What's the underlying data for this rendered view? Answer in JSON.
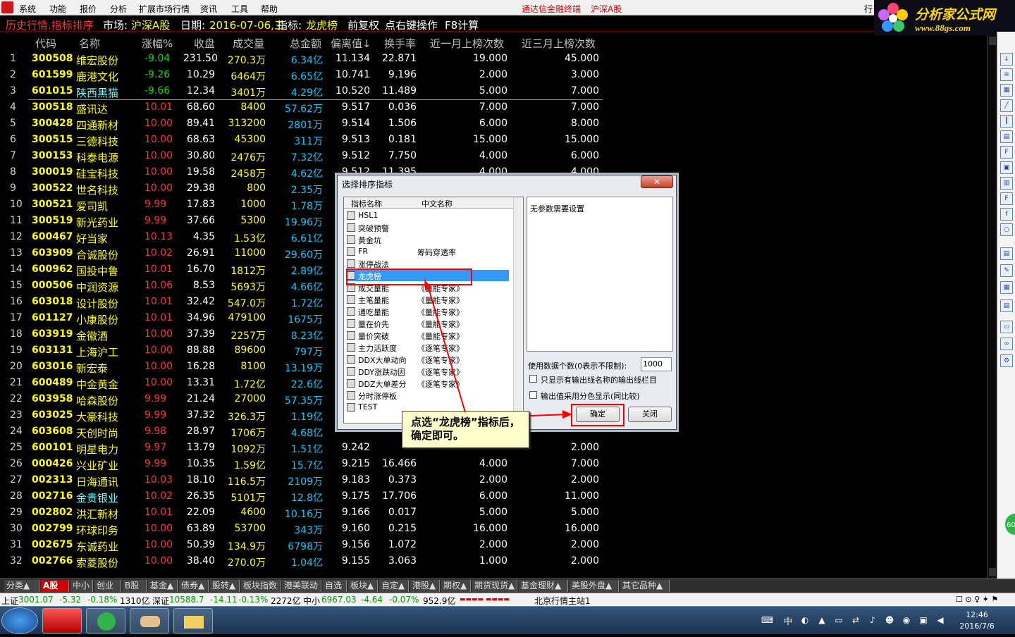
{
  "menubar": {
    "items": [
      "系统",
      "功能",
      "报价",
      "分析",
      "扩展市场行情",
      "资讯",
      "工具",
      "帮助"
    ],
    "right_text": "通达信金融终端",
    "market_text": "沪深A股",
    "right_cut": "行"
  },
  "brand": {
    "title": "分析家公式网",
    "url": "www.88gs.com"
  },
  "header": {
    "title": "历史行情.指标排序",
    "market_label": "市场:",
    "market": "沪深A股",
    "date_label": "日期:",
    "date": "2016-07-06,三",
    "indicator_label": "指标:",
    "indicator": "龙虎榜",
    "adjust": "前复权",
    "hint": "点右键操作",
    "calc": "F8计算"
  },
  "columns": [
    "代码",
    "名称",
    "涨幅%",
    "收盘",
    "成交量",
    "总金额",
    "偏离值↓",
    "换手率",
    "近一月上榜次数",
    "近三月上榜次数"
  ],
  "rows": [
    {
      "n": "1",
      "code": "300508",
      "name": "维宏股份",
      "pct": "-9.04",
      "close": "231.50",
      "vol": "270.3万",
      "amt": "6.34亿",
      "dev": "11.134",
      "turn": "22.871",
      "m1": "19.000",
      "m3": "45.000"
    },
    {
      "n": "2",
      "code": "601599",
      "name": "鹿港文化",
      "pct": "-9.26",
      "close": "10.29",
      "vol": "6464万",
      "amt": "6.65亿",
      "dev": "10.741",
      "turn": "9.196",
      "m1": "2.000",
      "m3": "3.000"
    },
    {
      "n": "3",
      "code": "601015",
      "name": "陕西黑猫",
      "pct": "-9.66",
      "close": "12.34",
      "vol": "3401万",
      "amt": "4.29亿",
      "dev": "10.520",
      "turn": "11.489",
      "m1": "5.000",
      "m3": "7.000"
    },
    {
      "n": "4",
      "code": "300518",
      "name": "盛讯达",
      "pct": "10.01",
      "close": "68.60",
      "vol": "8400",
      "amt": "57.62万",
      "dev": "9.517",
      "turn": "0.036",
      "m1": "7.000",
      "m3": "7.000"
    },
    {
      "n": "5",
      "code": "300428",
      "name": "四通新材",
      "pct": "10.00",
      "close": "89.41",
      "vol": "313200",
      "amt": "2801万",
      "dev": "9.514",
      "turn": "1.506",
      "m1": "6.000",
      "m3": "8.000"
    },
    {
      "n": "6",
      "code": "300515",
      "name": "三德科技",
      "pct": "10.00",
      "close": "68.63",
      "vol": "45300",
      "amt": "311万",
      "dev": "9.513",
      "turn": "0.181",
      "m1": "15.000",
      "m3": "15.000"
    },
    {
      "n": "7",
      "code": "300153",
      "name": "科泰电源",
      "pct": "10.00",
      "close": "30.80",
      "vol": "2476万",
      "amt": "7.32亿",
      "dev": "9.512",
      "turn": "7.750",
      "m1": "4.000",
      "m3": "6.000"
    },
    {
      "n": "8",
      "code": "300019",
      "name": "硅宝科技",
      "pct": "10.00",
      "close": "19.58",
      "vol": "2458万",
      "amt": "4.62亿",
      "dev": "9.512",
      "turn": "11.395",
      "m1": "4.000",
      "m3": "4.000"
    },
    {
      "n": "9",
      "code": "300522",
      "name": "世名科技",
      "pct": "10.00",
      "close": "29.38",
      "vol": "800",
      "amt": "2.35万",
      "dev": "",
      "turn": "",
      "m1": "",
      "m3": ""
    },
    {
      "n": "10",
      "code": "300521",
      "name": "爱司凯",
      "pct": "9.99",
      "close": "17.83",
      "vol": "1000",
      "amt": "1.78万",
      "dev": "",
      "turn": "",
      "m1": "",
      "m3": ""
    },
    {
      "n": "11",
      "code": "300519",
      "name": "新光药业",
      "pct": "9.99",
      "close": "37.66",
      "vol": "5300",
      "amt": "19.96万",
      "dev": "",
      "turn": "",
      "m1": "",
      "m3": ""
    },
    {
      "n": "12",
      "code": "600467",
      "name": "好当家",
      "pct": "10.13",
      "close": "4.35",
      "vol": "1.53亿",
      "amt": "6.61亿",
      "dev": "",
      "turn": "",
      "m1": "",
      "m3": ""
    },
    {
      "n": "13",
      "code": "603909",
      "name": "合诚股份",
      "pct": "10.02",
      "close": "26.91",
      "vol": "11000",
      "amt": "29.60万",
      "dev": "",
      "turn": "",
      "m1": "",
      "m3": ""
    },
    {
      "n": "14",
      "code": "600962",
      "name": "国投中鲁",
      "pct": "10.01",
      "close": "16.70",
      "vol": "1812万",
      "amt": "2.89亿",
      "dev": "",
      "turn": "",
      "m1": "",
      "m3": ""
    },
    {
      "n": "15",
      "code": "000506",
      "name": "中润资源",
      "pct": "10.06",
      "close": "8.53",
      "vol": "5693万",
      "amt": "4.66亿",
      "dev": "",
      "turn": "",
      "m1": "",
      "m3": ""
    },
    {
      "n": "16",
      "code": "603018",
      "name": "设计股份",
      "pct": "10.01",
      "close": "32.42",
      "vol": "547.0万",
      "amt": "1.72亿",
      "dev": "",
      "turn": "",
      "m1": "",
      "m3": ""
    },
    {
      "n": "17",
      "code": "601127",
      "name": "小康股份",
      "pct": "10.01",
      "close": "34.96",
      "vol": "479100",
      "amt": "1675万",
      "dev": "",
      "turn": "",
      "m1": "",
      "m3": ""
    },
    {
      "n": "18",
      "code": "603919",
      "name": "金徽酒",
      "pct": "10.00",
      "close": "37.39",
      "vol": "2257万",
      "amt": "8.23亿",
      "dev": "",
      "turn": "",
      "m1": "",
      "m3": ""
    },
    {
      "n": "19",
      "code": "603131",
      "name": "上海沪工",
      "pct": "10.00",
      "close": "88.88",
      "vol": "89600",
      "amt": "797万",
      "dev": "",
      "turn": "",
      "m1": "",
      "m3": ""
    },
    {
      "n": "20",
      "code": "603016",
      "name": "新宏泰",
      "pct": "10.00",
      "close": "16.28",
      "vol": "8100",
      "amt": "13.19万",
      "dev": "",
      "turn": "",
      "m1": "",
      "m3": ""
    },
    {
      "n": "21",
      "code": "600489",
      "name": "中金黄金",
      "pct": "10.00",
      "close": "13.31",
      "vol": "1.72亿",
      "amt": "22.6亿",
      "dev": "",
      "turn": "",
      "m1": "",
      "m3": ""
    },
    {
      "n": "22",
      "code": "603958",
      "name": "哈森股份",
      "pct": "9.99",
      "close": "21.24",
      "vol": "27000",
      "amt": "57.35万",
      "dev": "",
      "turn": "",
      "m1": "",
      "m3": ""
    },
    {
      "n": "23",
      "code": "603025",
      "name": "大豪科技",
      "pct": "9.99",
      "close": "37.32",
      "vol": "326.3万",
      "amt": "1.19亿",
      "dev": "",
      "turn": "",
      "m1": "",
      "m3": ""
    },
    {
      "n": "24",
      "code": "603608",
      "name": "天创时尚",
      "pct": "9.98",
      "close": "28.97",
      "vol": "1706万",
      "amt": "4.68亿",
      "dev": "",
      "turn": "",
      "m1": "",
      "m3": ""
    },
    {
      "n": "25",
      "code": "600101",
      "name": "明星电力",
      "pct": "9.97",
      "close": "13.79",
      "vol": "1092万",
      "amt": "1.51亿",
      "dev": "9.242",
      "turn": "",
      "m1": "",
      "m3": "2.000"
    },
    {
      "n": "26",
      "code": "000426",
      "name": "兴业矿业",
      "pct": "9.99",
      "close": "10.35",
      "vol": "1.59亿",
      "amt": "15.7亿",
      "dev": "9.215",
      "turn": "16.466",
      "m1": "4.000",
      "m3": "7.000"
    },
    {
      "n": "27",
      "code": "002313",
      "name": "日海通讯",
      "pct": "10.03",
      "close": "18.10",
      "vol": "116.5万",
      "amt": "2109万",
      "dev": "9.183",
      "turn": "0.373",
      "m1": "2.000",
      "m3": "2.000"
    },
    {
      "n": "28",
      "code": "002716",
      "name": "金贵银业",
      "pct": "10.02",
      "close": "26.35",
      "vol": "5101万",
      "amt": "12.8亿",
      "dev": "9.175",
      "turn": "17.706",
      "m1": "6.000",
      "m3": "11.000"
    },
    {
      "n": "29",
      "code": "002802",
      "name": "洪汇新材",
      "pct": "10.01",
      "close": "22.09",
      "vol": "4600",
      "amt": "10.16万",
      "dev": "9.166",
      "turn": "0.017",
      "m1": "5.000",
      "m3": "5.000"
    },
    {
      "n": "30",
      "code": "002799",
      "name": "环球印务",
      "pct": "10.00",
      "close": "63.89",
      "vol": "53700",
      "amt": "343万",
      "dev": "9.160",
      "turn": "0.215",
      "m1": "16.000",
      "m3": "16.000"
    },
    {
      "n": "31",
      "code": "002675",
      "name": "东诚药业",
      "pct": "10.00",
      "close": "50.39",
      "vol": "134.9万",
      "amt": "6798万",
      "dev": "9.156",
      "turn": "1.072",
      "m1": "2.000",
      "m3": "2.000"
    },
    {
      "n": "32",
      "code": "002766",
      "name": "索菱股份",
      "pct": "10.00",
      "close": "38.40",
      "vol": "270.0万",
      "amt": "1.04亿",
      "dev": "9.155",
      "turn": "3.063",
      "m1": "1.000",
      "m3": "2.000"
    }
  ],
  "dialog": {
    "title": "选择排序指标",
    "col_name": "指标名称",
    "col_cn": "中文名称",
    "items": [
      {
        "name": "HSL1",
        "cn": ""
      },
      {
        "name": "突破预警",
        "cn": ""
      },
      {
        "name": "黄金坑",
        "cn": ""
      },
      {
        "name": "FR",
        "cn": "筹码穿透率"
      },
      {
        "name": "涨停战法",
        "cn": ""
      },
      {
        "name": "龙虎榜",
        "cn": ""
      },
      {
        "name": "成交量能",
        "cn": "《量能专家》"
      },
      {
        "name": "主笔量能",
        "cn": "《量能专家》"
      },
      {
        "name": "通吃量能",
        "cn": "《量能专家》"
      },
      {
        "name": "量在价先",
        "cn": "《量能专家》"
      },
      {
        "name": "量价突破",
        "cn": "《量能专家》"
      },
      {
        "name": "主力活跃度",
        "cn": "《逐笔专家》"
      },
      {
        "name": "DDX大单动向",
        "cn": "《逐笔专家》"
      },
      {
        "name": "DDY涨跌动因",
        "cn": "《逐笔专家》"
      },
      {
        "name": "DDZ大单差分",
        "cn": "《逐笔专家》"
      },
      {
        "name": "分时涨停板",
        "cn": ""
      },
      {
        "name": "TEST",
        "cn": ""
      }
    ],
    "info": "无参数需要设置",
    "count_label": "使用数据个数(0表示不限制):",
    "count_value": "1000",
    "opt1": "只显示有输出线名称的输出线栏目",
    "opt2": "输出值采用分色显示(同比较)",
    "ok": "确定",
    "close": "关闭"
  },
  "callout": "点选“龙虎榜”指标后，确定即可。",
  "tabs": [
    "分类▲",
    "A股",
    "中小",
    "创业",
    "B股",
    "基金▲",
    "债券▲",
    "股转▲",
    "板块指数",
    "港美联动",
    "自选",
    "板块▲",
    "自定▲",
    "港股▲",
    "期权▲",
    "期货现货▲",
    "基金理财▲",
    "美股外盘▲",
    "其它品种▲"
  ],
  "status": {
    "sh_label": "上证",
    "sh": "3001.07",
    "sh_chg": "-5.32",
    "sh_pct": "-0.18%",
    "sh_amt": "1310亿",
    "sz_label": "深证",
    "sz": "10588.7",
    "sz_chg": "-14.11",
    "sz_pct": "-0.13%",
    "sz_amt": "2272亿",
    "zx_label": "中小",
    "zx": "6967.03",
    "zx_chg": "-4.64",
    "zx_pct": "-0.07%",
    "zx_amt": "952.9亿",
    "server": "北京行情主站1"
  },
  "taskbar": {
    "time": "12:46",
    "date": "2016/7/6",
    "ime": "中"
  },
  "green_badge": "60"
}
